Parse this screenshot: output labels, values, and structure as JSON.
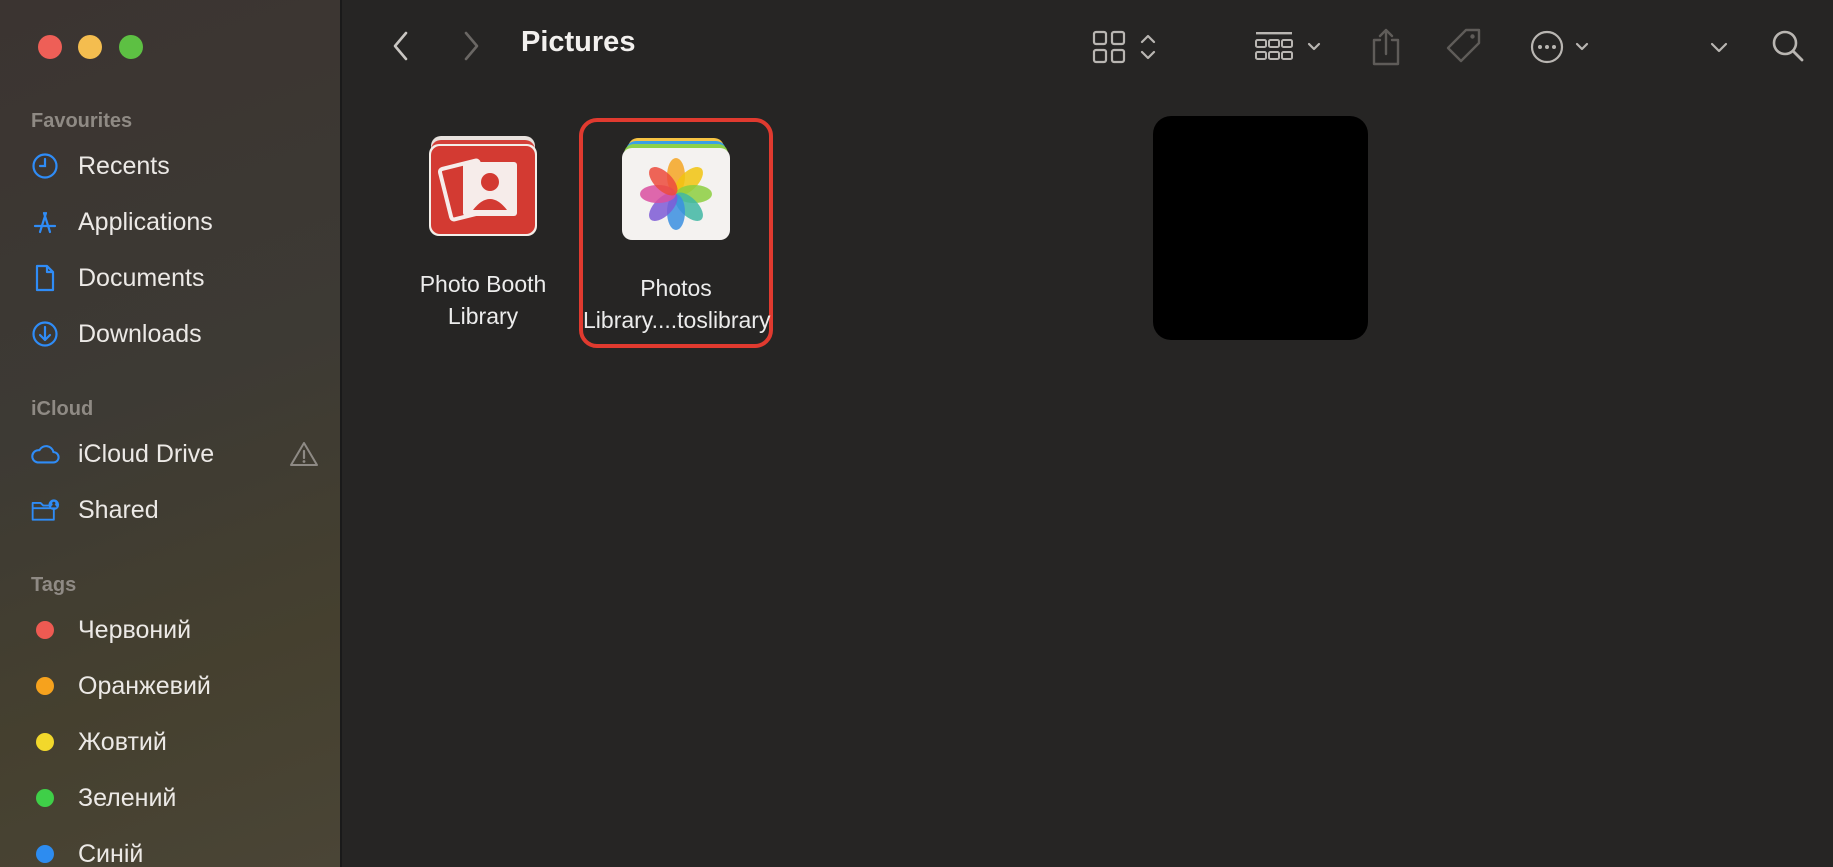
{
  "window": {
    "title": "Pictures"
  },
  "sidebar": {
    "sections": {
      "favourites": "Favourites",
      "icloud": "iCloud",
      "tags": "Tags"
    },
    "favourites": [
      {
        "label": "Recents",
        "icon": "clock-icon"
      },
      {
        "label": "Applications",
        "icon": "applications-icon"
      },
      {
        "label": "Documents",
        "icon": "document-icon"
      },
      {
        "label": "Downloads",
        "icon": "download-icon"
      }
    ],
    "icloud": [
      {
        "label": "iCloud Drive",
        "icon": "cloud-icon"
      },
      {
        "label": "Shared",
        "icon": "shared-folder-icon"
      }
    ],
    "tags": [
      {
        "label": "Червоний",
        "color": "#ee5a52"
      },
      {
        "label": "Оранжевий",
        "color": "#f6a21d"
      },
      {
        "label": "Жовтий",
        "color": "#f2d82b"
      },
      {
        "label": "Зелений",
        "color": "#3fcf48"
      },
      {
        "label": "Синій",
        "color": "#2d8cf0"
      }
    ]
  },
  "toolbar": {
    "back_icon": "chevron-left-icon",
    "forward_icon": "chevron-right-icon",
    "view_icon": "grid-view-icon",
    "group_icon": "group-icon",
    "share_icon": "share-icon",
    "tag_icon": "tag-icon",
    "more_icon": "ellipsis-circle-icon",
    "search_icon": "search-icon"
  },
  "files": [
    {
      "name_line1": "Photo Booth",
      "name_line2": "Library",
      "icon": "photo-booth-library-icon",
      "selected": false
    },
    {
      "name_line1": "Photos",
      "name_line2": "Library....toslibrary",
      "icon": "photos-library-icon",
      "selected": true
    }
  ],
  "colors": {
    "accent_selection": "#e03a2f",
    "sidebar_icon": "#2f8cf7"
  }
}
